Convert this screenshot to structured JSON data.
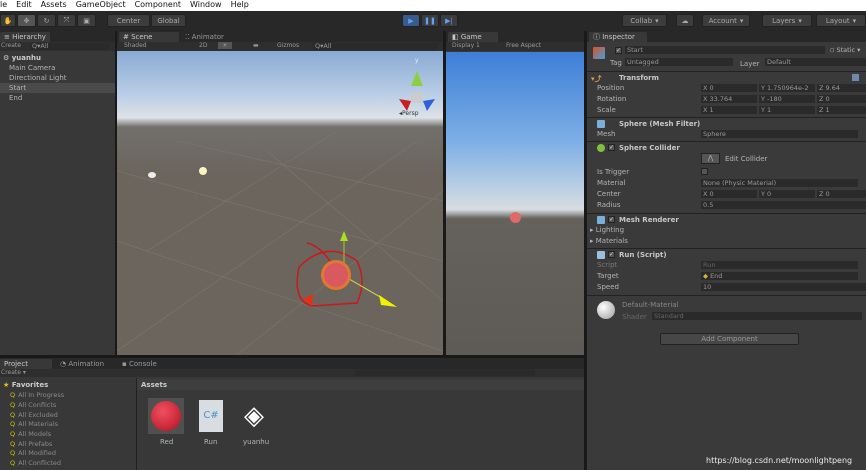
{
  "menu": [
    "le",
    "Edit",
    "Assets",
    "GameObject",
    "Component",
    "Window",
    "Help"
  ],
  "toolbar": {
    "center": "Center",
    "global": "Global",
    "collab": "Collab",
    "account": "Account",
    "layers": "Layers",
    "layout": "Layout"
  },
  "hierarchy": {
    "tab": "Hierarchy",
    "create": "Create",
    "search": "Q▾All",
    "scene": "yuanhu",
    "items": [
      "Main Camera",
      "Directional Light",
      "Start",
      "End"
    ]
  },
  "scene": {
    "tab": "Scene",
    "animator_tab": "Animator",
    "shading": "Shaded",
    "mode2d": "2D",
    "gizmos": "Gizmos",
    "search": "Q▾All",
    "persp": "Persp",
    "axis_y": "y"
  },
  "game": {
    "tab": "Game",
    "display": "Display 1",
    "aspect": "Free Aspect"
  },
  "inspector": {
    "tab": "Inspector",
    "object_name": "Start",
    "static": "Static",
    "tag_label": "Tag",
    "tag": "Untagged",
    "layer_label": "Layer",
    "layer": "Default",
    "transform": {
      "title": "Transform",
      "position": {
        "label": "Position",
        "x": "0",
        "y": "1.750964e-2",
        "z": "9.64"
      },
      "rotation": {
        "label": "Rotation",
        "x": "33.764",
        "y": "-180",
        "z": "0"
      },
      "scale": {
        "label": "Scale",
        "x": "1",
        "y": "1",
        "z": "1"
      }
    },
    "mesh_filter": {
      "title": "Sphere (Mesh Filter)",
      "mesh_label": "Mesh",
      "mesh": "Sphere"
    },
    "sphere_collider": {
      "title": "Sphere Collider",
      "edit": "Edit Collider",
      "is_trigger": "Is Trigger",
      "material_label": "Material",
      "material": "None (Physic Material)",
      "center_label": "Center",
      "cx": "0",
      "cy": "0",
      "cz": "0",
      "radius_label": "Radius",
      "radius": "0.5"
    },
    "mesh_renderer": {
      "title": "Mesh Renderer",
      "lighting": "Lighting",
      "materials": "Materials"
    },
    "run_script": {
      "title": "Run (Script)",
      "script_label": "Script",
      "script": "Run",
      "target_label": "Target",
      "target": "End",
      "speed_label": "Speed",
      "speed": "10"
    },
    "material": {
      "name": "Default-Material",
      "shader_label": "Shader",
      "shader": "Standard"
    },
    "add_component": "Add Component"
  },
  "project": {
    "tab": "Project",
    "animation_tab": "Animation",
    "console_tab": "Console",
    "create": "Create",
    "favorites": "Favorites",
    "fav_items": [
      "All In Progress",
      "All Conflicts",
      "All Excluded",
      "All Materials",
      "All Models",
      "All Prefabs",
      "All Modified",
      "All Conflicted"
    ],
    "assets_header": "Assets",
    "assets": [
      "Red",
      "Run",
      "yuanhu"
    ],
    "cs": "C#"
  },
  "watermark": "https://blog.csdn.net/moonlightpeng"
}
